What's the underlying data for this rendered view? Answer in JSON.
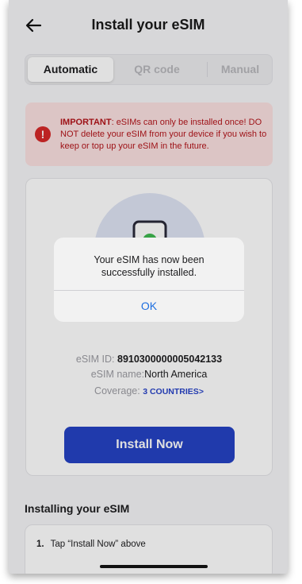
{
  "header": {
    "title": "Install your eSIM",
    "back_icon": "arrow-left-icon"
  },
  "tabs": [
    {
      "label": "Automatic",
      "active": true
    },
    {
      "label": "QR code",
      "active": false
    },
    {
      "label": "Manual",
      "active": false
    }
  ],
  "alert": {
    "icon": "exclamation-icon",
    "strong": "IMPORTANT",
    "text": ": eSIMs can only be installed once! DO NOT delete your eSIM from your device if you wish to keep or top up your eSIM in the future."
  },
  "esim": {
    "id_label": "eSIM ID:",
    "id_value": "8910300000005042133",
    "name_label": "eSIM name:",
    "name_value": "North America",
    "coverage_label": "Coverage:",
    "coverage_value": "3 COUNTRIES",
    "coverage_chevron": ">"
  },
  "install_button": "Install Now",
  "installing": {
    "title": "Installing your eSIM",
    "steps": [
      {
        "num": "1.",
        "text": "Tap “Install Now” above"
      }
    ]
  },
  "dialog": {
    "message": "Your eSIM has now been successfully installed.",
    "ok_label": "OK"
  },
  "colors": {
    "accent": "#2542c4",
    "alert_bg": "#fbe1e1",
    "alert_text": "#b4151b",
    "link": "#1f6fe0"
  }
}
